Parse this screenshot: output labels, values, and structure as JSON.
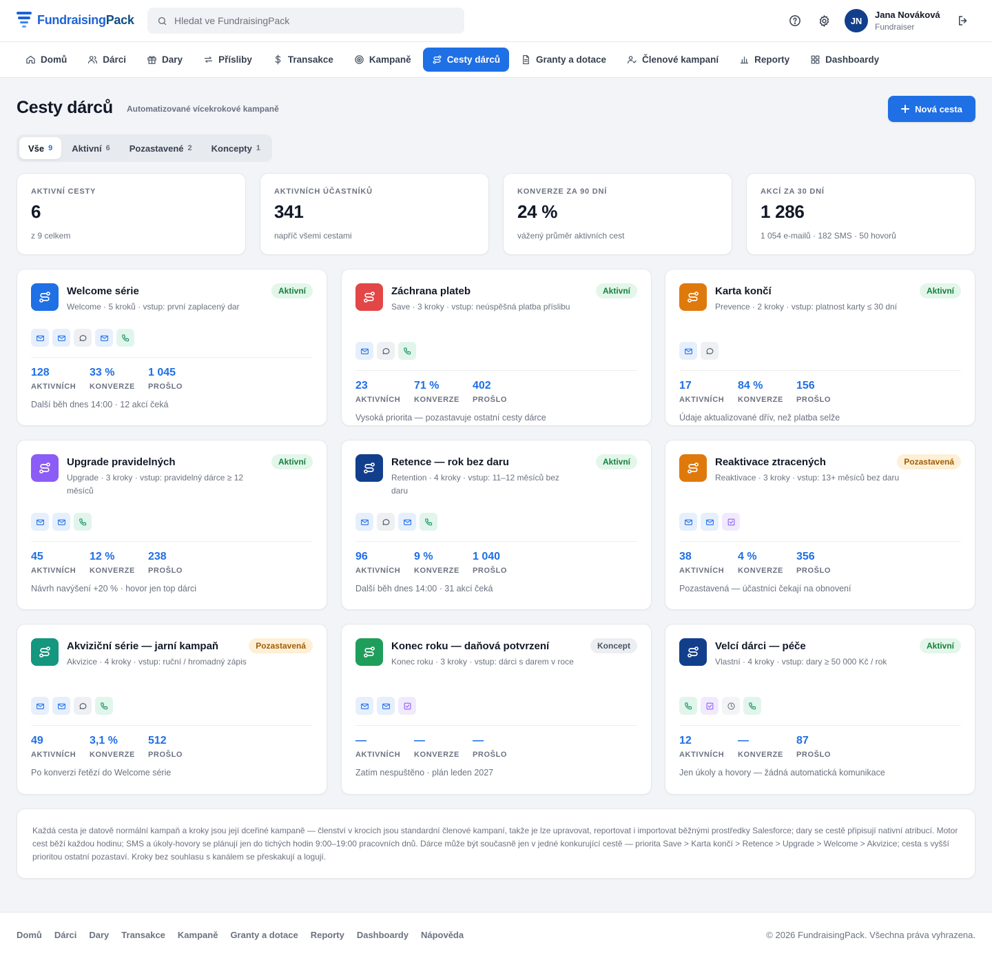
{
  "app": {
    "name_part1": "Fundraising",
    "name_part2": "Pack"
  },
  "search": {
    "placeholder": "Hledat ve FundraisingPack"
  },
  "user": {
    "initials": "JN",
    "name": "Jana Nováková",
    "role": "Fundraiser"
  },
  "nav": [
    {
      "label": "Domů",
      "icon": "home-icon"
    },
    {
      "label": "Dárci",
      "icon": "users-icon"
    },
    {
      "label": "Dary",
      "icon": "gift-icon"
    },
    {
      "label": "Přísliby",
      "icon": "repeat-icon"
    },
    {
      "label": "Transakce",
      "icon": "dollar-icon"
    },
    {
      "label": "Kampaně",
      "icon": "target-icon"
    },
    {
      "label": "Cesty dárců",
      "icon": "route-icon",
      "active": true
    },
    {
      "label": "Granty a dotace",
      "icon": "document-icon"
    },
    {
      "label": "Členové kampaní",
      "icon": "user-check-icon"
    },
    {
      "label": "Reporty",
      "icon": "bar-chart-icon"
    },
    {
      "label": "Dashboardy",
      "icon": "grid-icon"
    }
  ],
  "page": {
    "title": "Cesty dárců",
    "subtitle": "Automatizované vícekrokové kampaně",
    "new_button": "Nová cesta"
  },
  "filters": [
    {
      "label": "Vše",
      "count": "9",
      "active": true
    },
    {
      "label": "Aktivní",
      "count": "6"
    },
    {
      "label": "Pozastavené",
      "count": "2"
    },
    {
      "label": "Koncepty",
      "count": "1"
    }
  ],
  "stats": [
    {
      "label": "AKTIVNÍ CESTY",
      "value": "6",
      "note": "z 9 celkem"
    },
    {
      "label": "AKTIVNÍCH ÚČASTNÍKŮ",
      "value": "341",
      "note": "napříč všemi cestami"
    },
    {
      "label": "KONVERZE ZA 90 DNÍ",
      "value": "24 %",
      "note": "vážený průměr aktivních cest"
    },
    {
      "label": "AKCÍ ZA 30 DNÍ",
      "value": "1 286",
      "note": "1 054 e-mailů · 182 SMS · 50 hovorů"
    }
  ],
  "metric_labels": {
    "active": "AKTIVNÍCH",
    "conversion": "KONVERZE",
    "passed": "PROŠLO"
  },
  "journeys": [
    {
      "title": "Welcome série",
      "subtitle": "Welcome · 5 kroků · vstup: první zaplacený dar",
      "status": "Aktivní",
      "status_kind": "aktivni",
      "color": "#1f6fe5",
      "steps": [
        "email",
        "email",
        "sms",
        "email",
        "call"
      ],
      "active": "128",
      "conversion": "33 %",
      "passed": "1 045",
      "footer": "Další běh dnes 14:00 · 12 akcí čeká"
    },
    {
      "title": "Záchrana plateb",
      "subtitle": "Save · 3 kroky · vstup: neúspěšná platba příslibu",
      "status": "Aktivní",
      "status_kind": "aktivni",
      "color": "#e34646",
      "steps": [
        "email",
        "sms",
        "call"
      ],
      "active": "23",
      "conversion": "71 %",
      "passed": "402",
      "footer": "Vysoká priorita — pozastavuje ostatní cesty dárce"
    },
    {
      "title": "Karta končí",
      "subtitle": "Prevence · 2 kroky · vstup: platnost karty ≤ 30 dní",
      "status": "Aktivní",
      "status_kind": "aktivni",
      "color": "#e0790b",
      "steps": [
        "email",
        "sms"
      ],
      "active": "17",
      "conversion": "84 %",
      "passed": "156",
      "footer": "Údaje aktualizované dřív, než platba selže"
    },
    {
      "title": "Upgrade pravidelných",
      "subtitle": "Upgrade · 3 kroky · vstup: pravidelný dárce ≥ 12 měsíců",
      "status": "Aktivní",
      "status_kind": "aktivni",
      "color": "#8b5cf6",
      "steps": [
        "email",
        "email",
        "call"
      ],
      "active": "45",
      "conversion": "12 %",
      "passed": "238",
      "footer": "Návrh navýšení +20 % · hovor jen top dárci"
    },
    {
      "title": "Retence — rok bez daru",
      "subtitle": "Retention · 4 kroky · vstup: 11–12 měsíců bez daru",
      "status": "Aktivní",
      "status_kind": "aktivni",
      "color": "#123f8c",
      "steps": [
        "email",
        "sms",
        "email",
        "call"
      ],
      "active": "96",
      "conversion": "9 %",
      "passed": "1 040",
      "footer": "Další běh dnes 14:00 · 31 akcí čeká"
    },
    {
      "title": "Reaktivace ztracených",
      "subtitle": "Reaktivace · 3 kroky · vstup: 13+ měsíců bez daru",
      "status": "Pozastavená",
      "status_kind": "pozastavena",
      "color": "#e0790b",
      "steps": [
        "email",
        "email",
        "task"
      ],
      "active": "38",
      "conversion": "4 %",
      "passed": "356",
      "footer": "Pozastavená — účastníci čekají na obnovení"
    },
    {
      "title": "Akviziční série — jarní kampaň",
      "subtitle": "Akvizice · 4 kroky · vstup: ruční / hromadný zápis",
      "status": "Pozastavená",
      "status_kind": "pozastavena",
      "color": "#14967f",
      "steps": [
        "email",
        "email",
        "sms",
        "call"
      ],
      "active": "49",
      "conversion": "3,1 %",
      "passed": "512",
      "footer": "Po konverzi řetězí do Welcome série"
    },
    {
      "title": "Konec roku — daňová potvrzení",
      "subtitle": "Konec roku · 3 kroky · vstup: dárci s darem v roce",
      "status": "Koncept",
      "status_kind": "koncept",
      "color": "#1e9e5a",
      "steps": [
        "email",
        "email",
        "task"
      ],
      "active": "—",
      "conversion": "—",
      "passed": "—",
      "footer": "Zatím nespuštěno · plán leden 2027"
    },
    {
      "title": "Velcí dárci — péče",
      "subtitle": "Vlastní · 4 kroky · vstup: dary ≥ 50 000 Kč / rok",
      "status": "Aktivní",
      "status_kind": "aktivni",
      "color": "#123f8c",
      "steps": [
        "call",
        "task",
        "wait",
        "call"
      ],
      "active": "12",
      "conversion": "—",
      "passed": "87",
      "footer": "Jen úkoly a hovory — žádná automatická komunikace"
    }
  ],
  "info_text": "Každá cesta je datově normální kampaň a kroky jsou její dceřiné kampaně — členství v krocích jsou standardní členové kampaní, takže je lze upravovat, reportovat i importovat běžnými prostředky Salesforce; dary se cestě připisují nativní atribucí. Motor cest běží každou hodinu; SMS a úkoly-hovory se plánují jen do tichých hodin 9:00–19:00 pracovních dnů. Dárce může být současně jen v jedné konkurující cestě — priorita Save > Karta končí > Retence > Upgrade > Welcome > Akvizice; cesta s vyšší prioritou ostatní pozastaví. Kroky bez souhlasu s kanálem se přeskakují a logují.",
  "footer": {
    "links": [
      "Domů",
      "Dárci",
      "Dary",
      "Transakce",
      "Kampaně",
      "Granty a dotace",
      "Reporty",
      "Dashboardy",
      "Nápověda"
    ],
    "copyright": "© 2026 FundraisingPack. Všechna práva vyhrazena."
  }
}
